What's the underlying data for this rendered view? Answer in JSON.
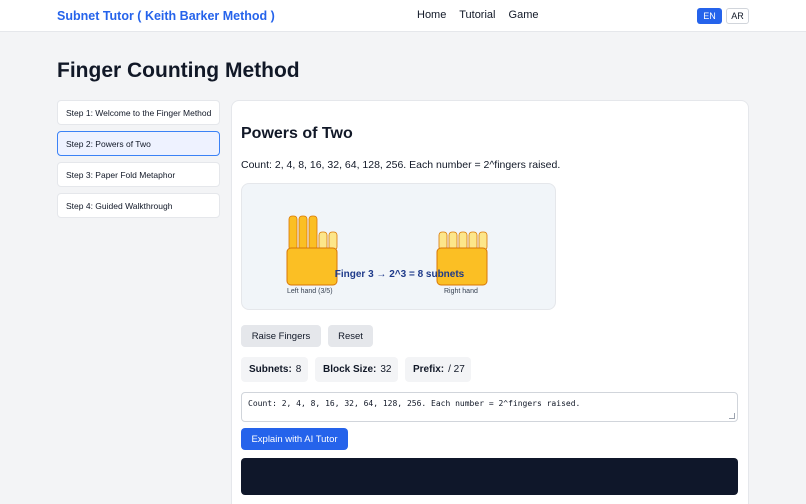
{
  "header": {
    "brand": "Subnet Tutor ( Keith Barker Method )",
    "nav": [
      "Home",
      "Tutorial",
      "Game"
    ],
    "languages": [
      {
        "label": "EN",
        "active": true
      },
      {
        "label": "AR",
        "active": false
      }
    ]
  },
  "page": {
    "title": "Finger Counting Method"
  },
  "steps": [
    {
      "label": "Step 1: Welcome to the Finger Method",
      "active": false
    },
    {
      "label": "Step 2: Powers of Two",
      "active": true
    },
    {
      "label": "Step 3: Paper Fold Metaphor",
      "active": false
    },
    {
      "label": "Step 4: Guided Walkthrough",
      "active": false
    }
  ],
  "content": {
    "title": "Powers of Two",
    "description": "Count: 2, 4, 8, 16, 32, 64, 128, 256. Each number = 2^fingers raised.",
    "visual": {
      "caption": "Finger 3 → 2^3 = 8 subnets",
      "left_hand_label": "Left hand (3/5)",
      "right_hand_label": "Right hand",
      "left_hand_raised": 3,
      "right_hand_raised": 0,
      "colors": {
        "raised": "#fbbf24",
        "lowered": "#fde68a",
        "stroke": "#d97706",
        "caption": "#1e3a8a"
      }
    },
    "buttons": {
      "raise": "Raise Fingers",
      "reset": "Reset",
      "explain": "Explain with AI Tutor"
    },
    "stats": {
      "subnets_label": "Subnets:",
      "subnets_value": "8",
      "block_label": "Block Size:",
      "block_value": "32",
      "prefix_label": "Prefix:",
      "prefix_value": "/ 27"
    },
    "textarea_value": "Count: 2, 4, 8, 16, 32, 64, 128, 256. Each number = 2^fingers raised."
  }
}
